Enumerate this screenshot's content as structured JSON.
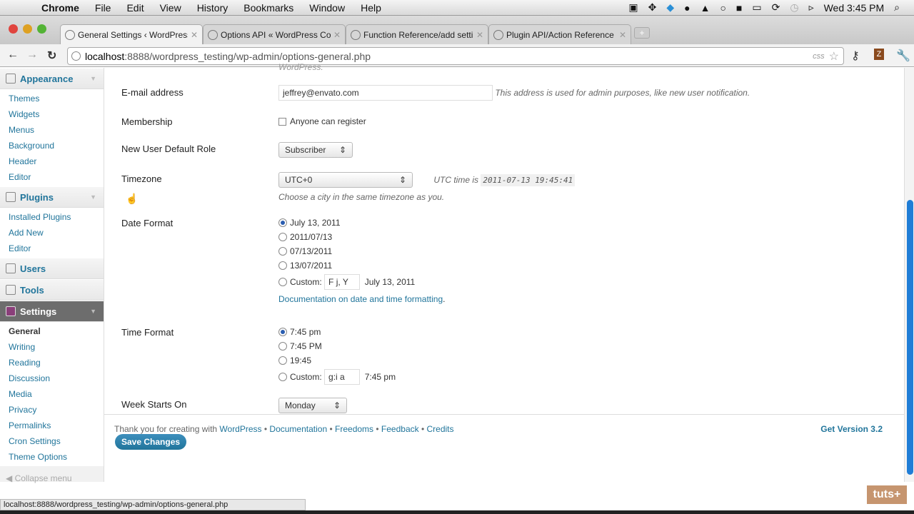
{
  "menubar": {
    "app": "Chrome",
    "items": [
      "File",
      "Edit",
      "View",
      "History",
      "Bookmarks",
      "Window",
      "Help"
    ],
    "clock": "Wed 3:45 PM"
  },
  "tabs": [
    {
      "label": "General Settings ‹ WordPress"
    },
    {
      "label": "Options API « WordPress Codex"
    },
    {
      "label": "Function Reference/add settings"
    },
    {
      "label": "Plugin API/Action Reference"
    }
  ],
  "address": {
    "url_host": "localhost",
    "url_rest": ":8888/wordpress_testing/wp-admin/options-general.php",
    "css_badge": "css"
  },
  "sidebar": {
    "appearance": {
      "label": "Appearance",
      "items": [
        "Themes",
        "Widgets",
        "Menus",
        "Background",
        "Header",
        "Editor"
      ]
    },
    "plugins": {
      "label": "Plugins",
      "items": [
        "Installed Plugins",
        "Add New",
        "Editor"
      ]
    },
    "users": "Users",
    "tools": "Tools",
    "settings": {
      "label": "Settings",
      "items": [
        "General",
        "Writing",
        "Reading",
        "Discussion",
        "Media",
        "Privacy",
        "Permalinks",
        "Cron Settings",
        "Theme Options"
      ]
    },
    "collapse": "Collapse menu"
  },
  "form": {
    "top_cut": "WordPress.",
    "email": {
      "label": "E-mail address",
      "value": "jeffrey@envato.com",
      "desc": "This address is used for admin purposes, like new user notification."
    },
    "membership": {
      "label": "Membership",
      "checkbox": "Anyone can register"
    },
    "role": {
      "label": "New User Default Role",
      "value": "Subscriber"
    },
    "timezone": {
      "label": "Timezone",
      "value": "UTC+0",
      "utc_label": "UTC time is",
      "utc_value": "2011-07-13 19:45:41",
      "desc": "Choose a city in the same timezone as you."
    },
    "date": {
      "label": "Date Format",
      "options": [
        "July 13, 2011",
        "2011/07/13",
        "07/13/2011",
        "13/07/2011"
      ],
      "custom_label": "Custom:",
      "custom_value": "F j, Y",
      "custom_preview": "July 13, 2011",
      "doc_link": "Documentation on date and time formatting",
      "doc_dot": "."
    },
    "time": {
      "label": "Time Format",
      "options": [
        "7:45 pm",
        "7:45 PM",
        "19:45"
      ],
      "custom_label": "Custom:",
      "custom_value": "g:i a",
      "custom_preview": "7:45 pm"
    },
    "week": {
      "label": "Week Starts On",
      "value": "Monday"
    },
    "save": "Save Changes"
  },
  "footer": {
    "thanks": "Thank you for creating with ",
    "wp": "WordPress",
    "links": [
      "Documentation",
      "Freedoms",
      "Feedback",
      "Credits"
    ],
    "sep": " • ",
    "version": "Get Version 3.2"
  },
  "status_url": "localhost:8888/wordpress_testing/wp-admin/options-general.php",
  "watermark": "tuts+"
}
